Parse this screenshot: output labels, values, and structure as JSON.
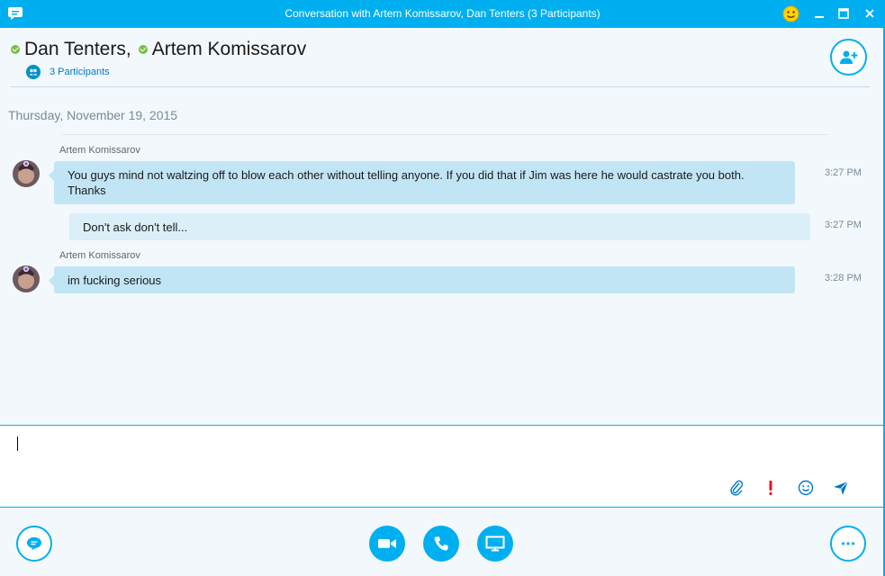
{
  "window": {
    "title": "Conversation with Artem Komissarov, Dan Tenters (3 Participants)"
  },
  "header": {
    "participants": [
      "Dan Tenters",
      "Artem Komissarov"
    ],
    "separator": ",",
    "participant_count": "3 Participants"
  },
  "conversation": {
    "date": "Thursday, November 19, 2015",
    "messages": [
      {
        "sender": "Artem Komissarov",
        "text": "You guys mind not waltzing off to blow each other without telling anyone. If you did that if Jim was here he would castrate you both. Thanks",
        "time": "3:27 PM",
        "direction": "incoming"
      },
      {
        "sender": "",
        "text": "Don't ask don't tell...",
        "time": "3:27 PM",
        "direction": "outgoing"
      },
      {
        "sender": "Artem Komissarov",
        "text": "im fucking serious",
        "time": "3:28 PM",
        "direction": "incoming"
      }
    ]
  },
  "compose": {
    "value": "",
    "tools": [
      "paperclip-icon",
      "urgent-icon",
      "emoticon-icon",
      "send-icon"
    ]
  },
  "bottombar": {
    "left": "chat-icon",
    "center": [
      "video-call-icon",
      "call-icon",
      "screen-share-icon"
    ],
    "right": "more-icon"
  },
  "colors": {
    "accent": "#00aff0",
    "incoming_bubble": "#c2e5f6",
    "outgoing_bubble": "#dbeff9",
    "online": "#7ac143",
    "urgent": "#e81123"
  }
}
